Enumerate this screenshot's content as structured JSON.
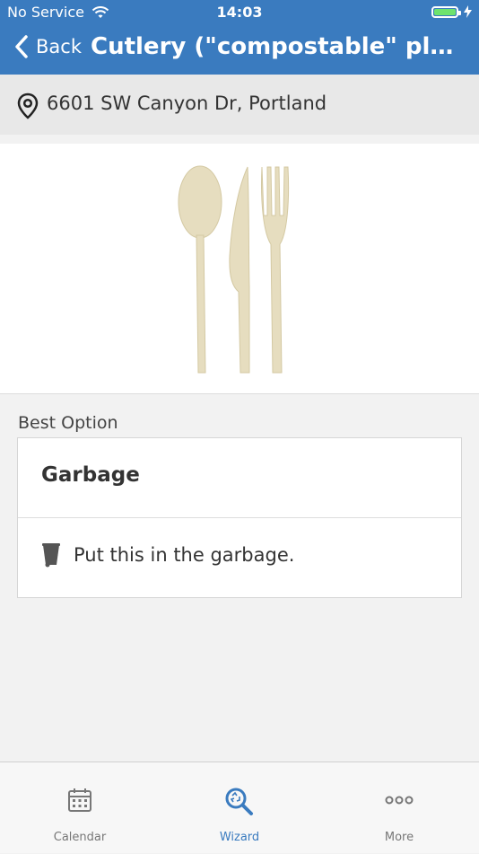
{
  "status_bar": {
    "carrier": "No Service",
    "time": "14:03"
  },
  "nav": {
    "back_label": "Back",
    "title": "Cutlery (\"compostable\" plast..."
  },
  "address": {
    "text": "6601 SW Canyon Dr, Portland"
  },
  "item_image": {
    "icon": "cutlery-image"
  },
  "best_option": {
    "label": "Best Option",
    "title": "Garbage",
    "instruction": "Put this in the garbage.",
    "icon": "garbage-bin-icon"
  },
  "tabs": [
    {
      "label": "Calendar",
      "icon": "calendar-icon",
      "active": false
    },
    {
      "label": "Wizard",
      "icon": "wizard-search-icon",
      "active": true
    },
    {
      "label": "More",
      "icon": "more-dots-icon",
      "active": false
    }
  ],
  "colors": {
    "header": "#3a7bbf",
    "active_tab": "#3a7bbf",
    "inactive_tab": "#777777"
  }
}
